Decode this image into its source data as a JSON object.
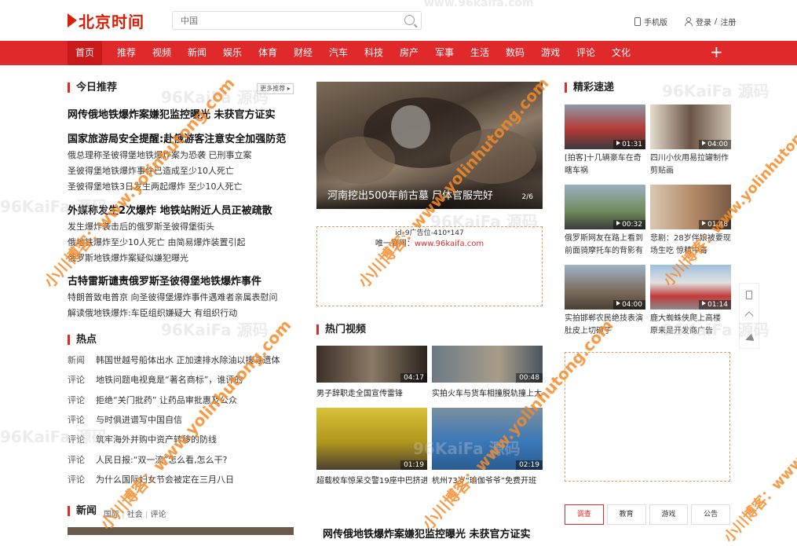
{
  "header": {
    "logo_text": "北京时间",
    "search_placeholder": "中国",
    "mobile_label": "手机版",
    "login_label": "登录",
    "register_label": "注册",
    "separator": "/"
  },
  "nav": {
    "items": [
      "首页",
      "推荐",
      "视频",
      "新闻",
      "娱乐",
      "体育",
      "财经",
      "汽车",
      "科技",
      "房产",
      "军事",
      "生活",
      "数码",
      "游戏",
      "评论",
      "文化"
    ],
    "active": "首页",
    "plus": "+"
  },
  "today": {
    "title": "今日推荐",
    "more": "更多推荐 ▸",
    "groups": [
      {
        "headline": "网传俄地铁爆炸案嫌犯监控曝光 未获官方证实",
        "subs": []
      },
      {
        "headline": "国家旅游局安全提醒:赴俄游客注意安全加强防范",
        "subs": [
          "俄总理称圣彼得堡地铁爆炸案为恐袭 已刑事立案",
          "圣彼得堡地铁爆炸事件已造成至少10人死亡",
          "圣彼得堡地铁3日发生两起爆炸 至少10人死亡"
        ]
      },
      {
        "headline": "外媒称发生2次爆炸 地铁站附近人员正被疏散",
        "subs": [
          "发生爆炸袭击后的俄罗斯圣彼得堡街头",
          "俄地铁爆炸至少10人死亡 由简易爆炸装置引起",
          "俄罗斯地铁爆炸案疑似嫌犯曝光"
        ]
      },
      {
        "headline": "古特雷斯谴责俄罗斯圣彼得堡地铁爆炸事件",
        "subs": [
          "特朗普致电普京 向圣彼得堡爆炸事件遇难者亲属表慰问",
          "解读俄地铁爆炸:车臣组织嫌疑大 有组织行动"
        ]
      }
    ]
  },
  "hot": {
    "title": "热点",
    "rows": [
      {
        "tag": "新闻",
        "text": "韩国世越号船体出水 正加速排水除油以搜寻遗体"
      },
      {
        "tag": "评论",
        "text": "地铁问题电视竟是“著名商标”，谁评的"
      },
      {
        "tag": "评论",
        "text": "拒绝“关门批药” 让药品审批惠及公众"
      },
      {
        "tag": "评论",
        "text": "与时俱进谱写中国自信"
      },
      {
        "tag": "评论",
        "text": "筑牢海外并购中资产转移的防线"
      },
      {
        "tag": "评论",
        "text": "人民日报:“双一流”怎么看,怎么干?"
      },
      {
        "tag": "评论",
        "text": "为什么国际妇女节会被定在三月八日"
      }
    ]
  },
  "news": {
    "title": "新闻",
    "tabs": [
      "国际",
      "社会",
      "评论"
    ],
    "bottom_headline": "网传俄地铁爆炸案嫌犯监控曝光 未获官方证实"
  },
  "slider": {
    "title": "河南挖出500年前古墓 尸体官服完好",
    "counter": "2/6"
  },
  "ad_mid": {
    "label": "id_9广告位-410*147",
    "line_prefix": "唯一官网：",
    "url": "www.96kaifa.com"
  },
  "hot_video": {
    "title": "热门视频",
    "items": [
      {
        "duration": "04:17",
        "title": "男子辞职走全国宣传雷锋"
      },
      {
        "duration": "00:48",
        "title": "实拍火车与货车相撞脱轨撞上大"
      },
      {
        "duration": "01:19",
        "title": "超载校车惊呆交警19座中巴挤进"
      },
      {
        "duration": "02:19",
        "title": "杭州73岁“瑜伽爷爷”免费开班"
      }
    ]
  },
  "featured": {
    "title": "精彩速递",
    "items": [
      {
        "duration": "01:31",
        "title": "[拍客]十几辆豪车在奇瞎车祸"
      },
      {
        "duration": "04:00",
        "title": "四川小伙用易拉罐制作剪贴画"
      },
      {
        "duration": "00:32",
        "title": "俄罗斯网友在路上看到前面骑摩托车的背影有"
      },
      {
        "duration": "01:48",
        "title": "悲剧：28岁伴娘被要现场生吃 惊精中毒"
      },
      {
        "duration": "04:00",
        "title": "实拍邯郸农民绝技表演肚皮上切碗子"
      },
      {
        "duration": "01:14",
        "title": "鹿大蜘蛛侠爬上高楼 原来是开发商广告"
      }
    ]
  },
  "poll_tabs": [
    "调查",
    "教育",
    "游戏",
    "公告"
  ],
  "poll_active": "调查",
  "watermarks": {
    "brand": "96KaiFa 源码",
    "site": "www.96kaifa.com",
    "stamp": "小川博客：www.yolinhutong.com"
  },
  "colors": {
    "brand_red": "#e0292b",
    "nav_active": "#c8191b",
    "ad_border": "#e89a55"
  }
}
